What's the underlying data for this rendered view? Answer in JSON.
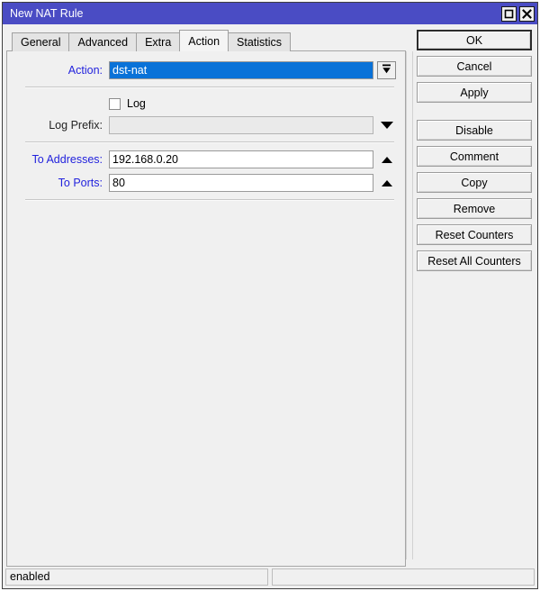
{
  "window": {
    "title": "New NAT Rule",
    "title_bar_color": "#4a4cc4",
    "buttons": {
      "maximize_icon": "maximize-icon",
      "close_icon": "close-icon"
    }
  },
  "tabs": [
    {
      "label": "General",
      "active": false
    },
    {
      "label": "Advanced",
      "active": false
    },
    {
      "label": "Extra",
      "active": false
    },
    {
      "label": "Action",
      "active": true
    },
    {
      "label": "Statistics",
      "active": false
    }
  ],
  "form": {
    "action": {
      "label": "Action:",
      "value": "dst-nat",
      "selected": true,
      "dropdown_icon": "collapse-down-icon"
    },
    "log": {
      "label": "Log",
      "checked": false
    },
    "log_prefix": {
      "label": "Log Prefix:",
      "value": "",
      "placeholder": "",
      "disabled": true,
      "dropdown_icon": "chevron-down-icon"
    },
    "to_addresses": {
      "label": "To Addresses:",
      "value": "192.168.0.20",
      "expander_icon": "chevron-up-icon"
    },
    "to_ports": {
      "label": "To Ports:",
      "value": "80",
      "expander_icon": "chevron-up-icon"
    }
  },
  "actions": [
    {
      "label": "OK",
      "default": true
    },
    {
      "label": "Cancel",
      "default": false
    },
    {
      "label": "Apply",
      "default": false
    },
    {
      "label": "Disable",
      "default": false
    },
    {
      "label": "Comment",
      "default": false
    },
    {
      "label": "Copy",
      "default": false
    },
    {
      "label": "Remove",
      "default": false
    },
    {
      "label": "Reset Counters",
      "default": false
    },
    {
      "label": "Reset All Counters",
      "default": false
    }
  ],
  "statusbar": {
    "status": "enabled",
    "secondary": ""
  }
}
